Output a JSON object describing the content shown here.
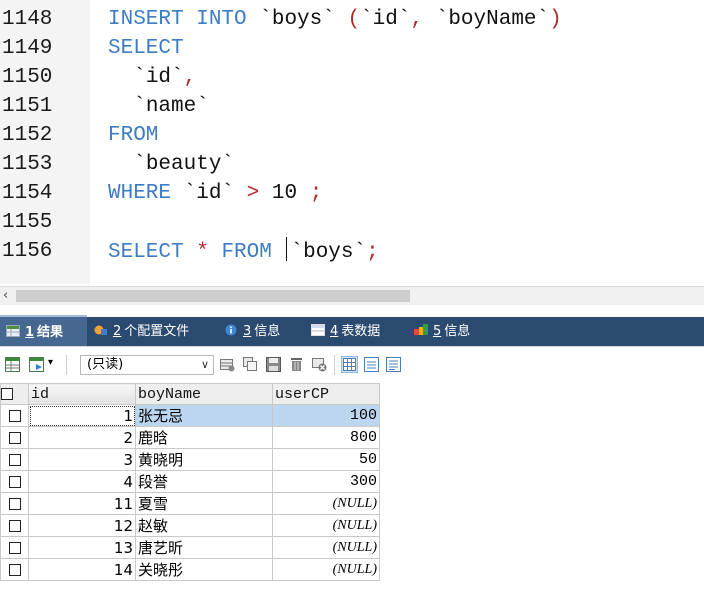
{
  "editor": {
    "lines": [
      {
        "n": "1148"
      },
      {
        "n": "1149"
      },
      {
        "n": "1150"
      },
      {
        "n": "1151"
      },
      {
        "n": "1152"
      },
      {
        "n": "1153"
      },
      {
        "n": "1154"
      },
      {
        "n": "1155"
      },
      {
        "n": "1156"
      }
    ],
    "tokens": {
      "l1_kw": "INSERT INTO",
      "l1_tbl": "`boys`",
      "l1_open": "(",
      "l1_c1": "`id`",
      "l1_comma": ",",
      "l1_c2": "`boyName`",
      "l1_close": ")",
      "l2_kw": "SELECT",
      "l3_col": "`id`",
      "l3_comma": ",",
      "l4_col": "`name`",
      "l5_kw": "FROM",
      "l6_tbl": "`beauty`",
      "l7_kw": "WHERE",
      "l7_col": "`id`",
      "l7_op": ">",
      "l7_num": "10",
      "l7_semi": ";",
      "l9_kw1": "SELECT",
      "l9_star": "*",
      "l9_kw2": "FROM",
      "l9_tbl": "`boys`",
      "l9_semi": ";"
    }
  },
  "tabs": [
    {
      "key": "1",
      "label": "结果"
    },
    {
      "key": "2",
      "label": "个配置文件"
    },
    {
      "key": "3",
      "label": "信息"
    },
    {
      "key": "4",
      "label": "表数据"
    },
    {
      "key": "5",
      "label": "信息"
    }
  ],
  "toolbar": {
    "readonly_label": "(只读)"
  },
  "colors": {
    "keyword": "#3e7cc4",
    "operator": "#b02a2a",
    "tab_bar": "#2b4a6f",
    "selection": "#bcd6f0"
  },
  "grid": {
    "columns": [
      "id",
      "boyName",
      "userCP"
    ],
    "rows": [
      {
        "id": "1",
        "boyName": "张无忌",
        "userCP": "100"
      },
      {
        "id": "2",
        "boyName": "鹿晗",
        "userCP": "800"
      },
      {
        "id": "3",
        "boyName": "黄晓明",
        "userCP": "50"
      },
      {
        "id": "4",
        "boyName": "段誉",
        "userCP": "300"
      },
      {
        "id": "11",
        "boyName": "夏雪",
        "userCP": "(NULL)"
      },
      {
        "id": "12",
        "boyName": "赵敏",
        "userCP": "(NULL)"
      },
      {
        "id": "13",
        "boyName": "唐艺昕",
        "userCP": "(NULL)"
      },
      {
        "id": "14",
        "boyName": "关晓彤",
        "userCP": "(NULL)"
      }
    ]
  }
}
